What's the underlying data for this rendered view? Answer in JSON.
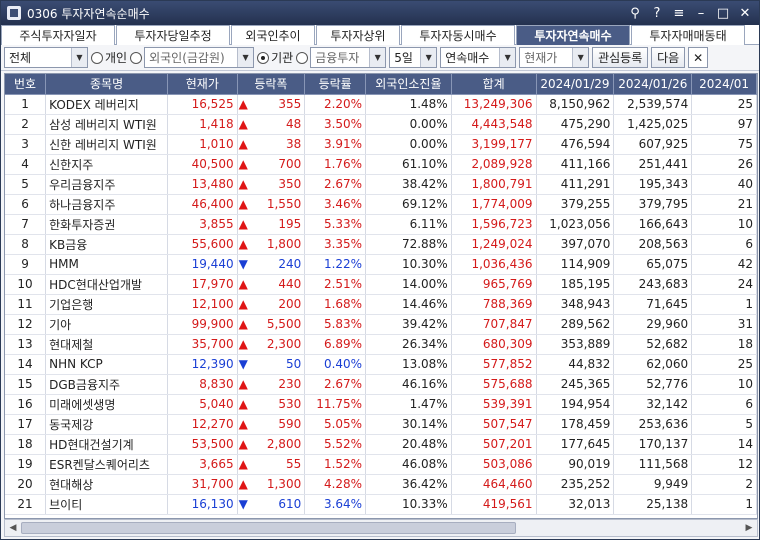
{
  "window": {
    "title": "0306 투자자연속순매수"
  },
  "tabs": [
    {
      "label": "주식투자자일자",
      "active": false
    },
    {
      "label": "투자자당일추정",
      "active": false
    },
    {
      "label": "외국인추이",
      "active": false
    },
    {
      "label": "투자자상위",
      "active": false
    },
    {
      "label": "투자자동시매수",
      "active": false
    },
    {
      "label": "투자자연속매수",
      "active": true
    },
    {
      "label": "투자자매매동태",
      "active": false
    }
  ],
  "toolbar": {
    "market_select": "전체",
    "radio_individual": "개인",
    "radio_foreign": "외국인(금감원)",
    "radio_institution": "기관",
    "radio_finance": "금융투자",
    "period_select": "5일",
    "type_select": "연속매수",
    "price_select": "현재가",
    "watch_button": "관심등록",
    "next_button": "다음"
  },
  "table": {
    "headers": [
      "번호",
      "종목명",
      "현재가",
      "등락폭",
      "등락률",
      "외국인소진율",
      "합계",
      "2024/01/29",
      "2024/01/26",
      "2024/01"
    ],
    "rows": [
      {
        "no": "1",
        "name": "KODEX 레버리지",
        "price": "16,525",
        "dir": "up",
        "change": "355",
        "rate": "2.20%",
        "foreign": "1.48%",
        "total": "13,249,306",
        "d1": "8,150,962",
        "d2": "2,539,574",
        "d3": "25"
      },
      {
        "no": "2",
        "name": "삼성 레버리지 WTI원",
        "price": "1,418",
        "dir": "up",
        "change": "48",
        "rate": "3.50%",
        "foreign": "0.00%",
        "total": "4,443,548",
        "d1": "475,290",
        "d2": "1,425,025",
        "d3": "97"
      },
      {
        "no": "3",
        "name": "신한 레버리지 WTI원",
        "price": "1,010",
        "dir": "up",
        "change": "38",
        "rate": "3.91%",
        "foreign": "0.00%",
        "total": "3,199,177",
        "d1": "476,594",
        "d2": "607,925",
        "d3": "75"
      },
      {
        "no": "4",
        "name": "신한지주",
        "price": "40,500",
        "dir": "up",
        "change": "700",
        "rate": "1.76%",
        "foreign": "61.10%",
        "total": "2,089,928",
        "d1": "411,166",
        "d2": "251,441",
        "d3": "26"
      },
      {
        "no": "5",
        "name": "우리금융지주",
        "price": "13,480",
        "dir": "up",
        "change": "350",
        "rate": "2.67%",
        "foreign": "38.42%",
        "total": "1,800,791",
        "d1": "411,291",
        "d2": "195,343",
        "d3": "40"
      },
      {
        "no": "6",
        "name": "하나금융지주",
        "price": "46,400",
        "dir": "up",
        "change": "1,550",
        "rate": "3.46%",
        "foreign": "69.12%",
        "total": "1,774,009",
        "d1": "379,255",
        "d2": "379,795",
        "d3": "21"
      },
      {
        "no": "7",
        "name": "한화투자증권",
        "price": "3,855",
        "dir": "up",
        "change": "195",
        "rate": "5.33%",
        "foreign": "6.11%",
        "total": "1,596,723",
        "d1": "1,023,056",
        "d2": "166,643",
        "d3": "10"
      },
      {
        "no": "8",
        "name": "KB금융",
        "price": "55,600",
        "dir": "up",
        "change": "1,800",
        "rate": "3.35%",
        "foreign": "72.88%",
        "total": "1,249,024",
        "d1": "397,070",
        "d2": "208,563",
        "d3": "6"
      },
      {
        "no": "9",
        "name": "HMM",
        "price": "19,440",
        "dir": "down",
        "change": "240",
        "rate": "1.22%",
        "foreign": "10.30%",
        "total": "1,036,436",
        "d1": "114,909",
        "d2": "65,075",
        "d3": "42"
      },
      {
        "no": "10",
        "name": "HDC현대산업개발",
        "price": "17,970",
        "dir": "up",
        "change": "440",
        "rate": "2.51%",
        "foreign": "14.00%",
        "total": "965,769",
        "d1": "185,195",
        "d2": "243,683",
        "d3": "24"
      },
      {
        "no": "11",
        "name": "기업은행",
        "price": "12,100",
        "dir": "up",
        "change": "200",
        "rate": "1.68%",
        "foreign": "14.46%",
        "total": "788,369",
        "d1": "348,943",
        "d2": "71,645",
        "d3": "1"
      },
      {
        "no": "12",
        "name": "기아",
        "price": "99,900",
        "dir": "up",
        "change": "5,500",
        "rate": "5.83%",
        "foreign": "39.42%",
        "total": "707,847",
        "d1": "289,562",
        "d2": "29,960",
        "d3": "31"
      },
      {
        "no": "13",
        "name": "현대제철",
        "price": "35,700",
        "dir": "up",
        "change": "2,300",
        "rate": "6.89%",
        "foreign": "26.34%",
        "total": "680,309",
        "d1": "353,889",
        "d2": "52,682",
        "d3": "18"
      },
      {
        "no": "14",
        "name": "NHN KCP",
        "price": "12,390",
        "dir": "down",
        "change": "50",
        "rate": "0.40%",
        "foreign": "13.08%",
        "total": "577,852",
        "d1": "44,832",
        "d2": "62,060",
        "d3": "25"
      },
      {
        "no": "15",
        "name": "DGB금융지주",
        "price": "8,830",
        "dir": "up",
        "change": "230",
        "rate": "2.67%",
        "foreign": "46.16%",
        "total": "575,688",
        "d1": "245,365",
        "d2": "52,776",
        "d3": "10"
      },
      {
        "no": "16",
        "name": "미래에셋생명",
        "price": "5,040",
        "dir": "up",
        "change": "530",
        "rate": "11.75%",
        "foreign": "1.47%",
        "total": "539,391",
        "d1": "194,954",
        "d2": "32,142",
        "d3": "6"
      },
      {
        "no": "17",
        "name": "동국제강",
        "price": "12,270",
        "dir": "up",
        "change": "590",
        "rate": "5.05%",
        "foreign": "30.14%",
        "total": "507,547",
        "d1": "178,459",
        "d2": "253,636",
        "d3": "5"
      },
      {
        "no": "18",
        "name": "HD현대건설기계",
        "price": "53,500",
        "dir": "up",
        "change": "2,800",
        "rate": "5.52%",
        "foreign": "20.48%",
        "total": "507,201",
        "d1": "177,645",
        "d2": "170,137",
        "d3": "14"
      },
      {
        "no": "19",
        "name": "ESR켄달스퀘어리츠",
        "price": "3,665",
        "dir": "up",
        "change": "55",
        "rate": "1.52%",
        "foreign": "46.08%",
        "total": "503,086",
        "d1": "90,019",
        "d2": "111,568",
        "d3": "12"
      },
      {
        "no": "20",
        "name": "현대해상",
        "price": "31,700",
        "dir": "up",
        "change": "1,300",
        "rate": "4.28%",
        "foreign": "36.42%",
        "total": "464,460",
        "d1": "235,252",
        "d2": "9,949",
        "d3": "2"
      },
      {
        "no": "21",
        "name": "브이티",
        "price": "16,130",
        "dir": "down",
        "change": "610",
        "rate": "3.64%",
        "foreign": "10.33%",
        "total": "419,561",
        "d1": "32,013",
        "d2": "25,138",
        "d3": "1"
      }
    ]
  }
}
